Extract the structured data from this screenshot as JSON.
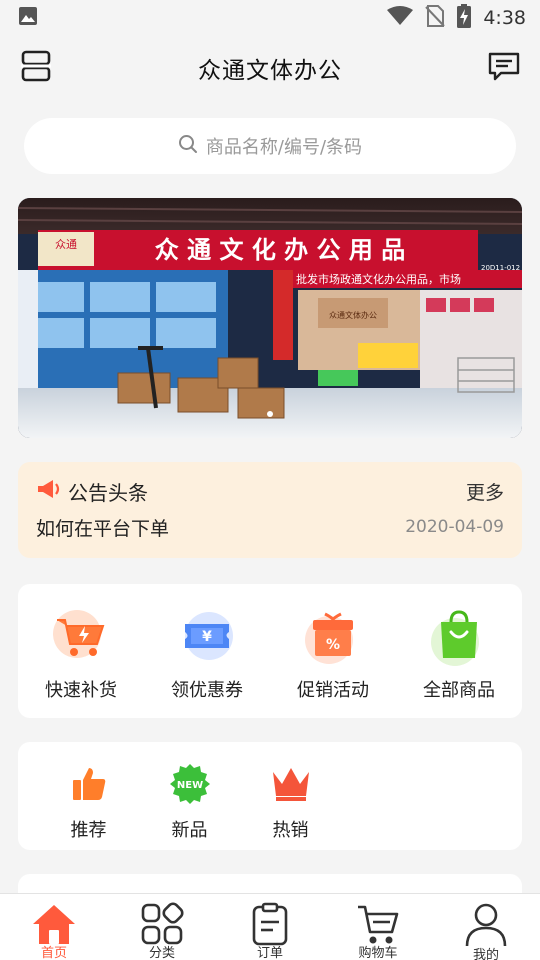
{
  "status_bar": {
    "time": "4:38"
  },
  "header": {
    "title": "众通文体办公",
    "left_icon": "scan-icon",
    "right_icon": "message-icon"
  },
  "search": {
    "placeholder": "商品名称/编号/条码"
  },
  "banner": {
    "sign_text": "众 通 文 化 办 公 用 品",
    "logo_text": "众通",
    "side_text": "批发市场政通文化办公用品，市场",
    "code_text": "20D11-012",
    "counter_text": "众通文体办公",
    "indicator_count": 1
  },
  "notice": {
    "label": "公告头条",
    "more": "更多",
    "headline": "如何在平台下单",
    "date": "2020-04-09"
  },
  "quick_actions": [
    {
      "label": "快速补货",
      "icon": "cart-lightning-icon"
    },
    {
      "label": "领优惠券",
      "icon": "coupon-icon"
    },
    {
      "label": "促销活动",
      "icon": "gift-percent-icon"
    },
    {
      "label": "全部商品",
      "icon": "shopping-bag-icon"
    }
  ],
  "tags": [
    {
      "label": "推荐",
      "icon": "thumbs-up-icon"
    },
    {
      "label": "新品",
      "icon": "new-badge-icon",
      "badge": "NEW"
    },
    {
      "label": "热销",
      "icon": "crown-icon"
    }
  ],
  "tabbar": [
    {
      "label": "首页",
      "icon": "home-icon",
      "active": true
    },
    {
      "label": "分类",
      "icon": "category-icon",
      "active": false
    },
    {
      "label": "订单",
      "icon": "order-icon",
      "active": false
    },
    {
      "label": "购物车",
      "icon": "cart-icon",
      "active": false
    },
    {
      "label": "我的",
      "icon": "user-icon",
      "active": false
    }
  ],
  "colors": {
    "accent": "#ff5a3c",
    "notice_bg": "#fdf0de",
    "page_bg": "#f4f4f4"
  }
}
